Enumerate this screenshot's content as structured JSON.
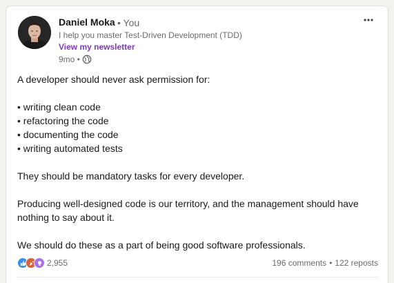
{
  "post": {
    "author": {
      "name": "Daniel Moka",
      "relation": "• You",
      "headline": "I help you master Test-Driven Development (TDD)",
      "newsletter_link": "View my newsletter",
      "age": "9mo •"
    },
    "icons": {
      "visibility": "globe-icon",
      "menu": "more-options-icon",
      "reactions": [
        "like-icon",
        "celebrate-icon",
        "insightful-icon"
      ]
    },
    "body_lines": [
      "A developer should never ask permission for:",
      "",
      "• writing clean code",
      "• refactoring the code",
      "• documenting the code",
      "• writing automated tests",
      "",
      "They should be mandatory tasks for every developer.",
      "",
      "Producing well-designed code is our territory, and the management should have",
      "nothing to say about it.",
      "",
      "We should do these as a part of being good software professionals."
    ],
    "social": {
      "reaction_count": "2,955",
      "comments": "196 comments",
      "separator": "•",
      "reposts": "122 reposts"
    }
  },
  "colors": {
    "link": "#7b3bb5",
    "like": "#378fe9",
    "celebrate": "#d4633c",
    "insightful": "#a872e8"
  }
}
